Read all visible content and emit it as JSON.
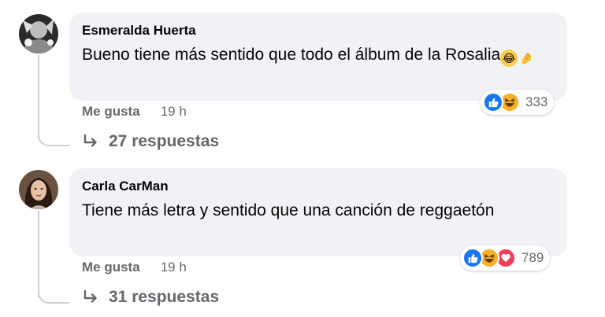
{
  "comments": [
    {
      "author": "Esmeralda Huerta",
      "text": "Bueno tiene más sentido que todo el álbum de la Rosalia",
      "emojis": [
        "rofl",
        "pinched-fingers"
      ],
      "like_label": "Me gusta",
      "time": "19 h",
      "reaction_types": [
        "like",
        "haha"
      ],
      "reaction_count": "333",
      "replies_label": "27 respuestas"
    },
    {
      "author": "Carla CarMan",
      "text": "Tiene más letra y sentido que una canción de reggaetón",
      "emojis": [],
      "like_label": "Me gusta",
      "time": "19 h",
      "reaction_types": [
        "like",
        "haha",
        "love"
      ],
      "reaction_count": "789",
      "replies_label": "31 respuestas"
    }
  ],
  "colors": {
    "bubble": "#f0f2f5",
    "like": "#1877f2",
    "haha": "#f7b125",
    "love": "#f33e58",
    "secondary_text": "#65676b"
  }
}
